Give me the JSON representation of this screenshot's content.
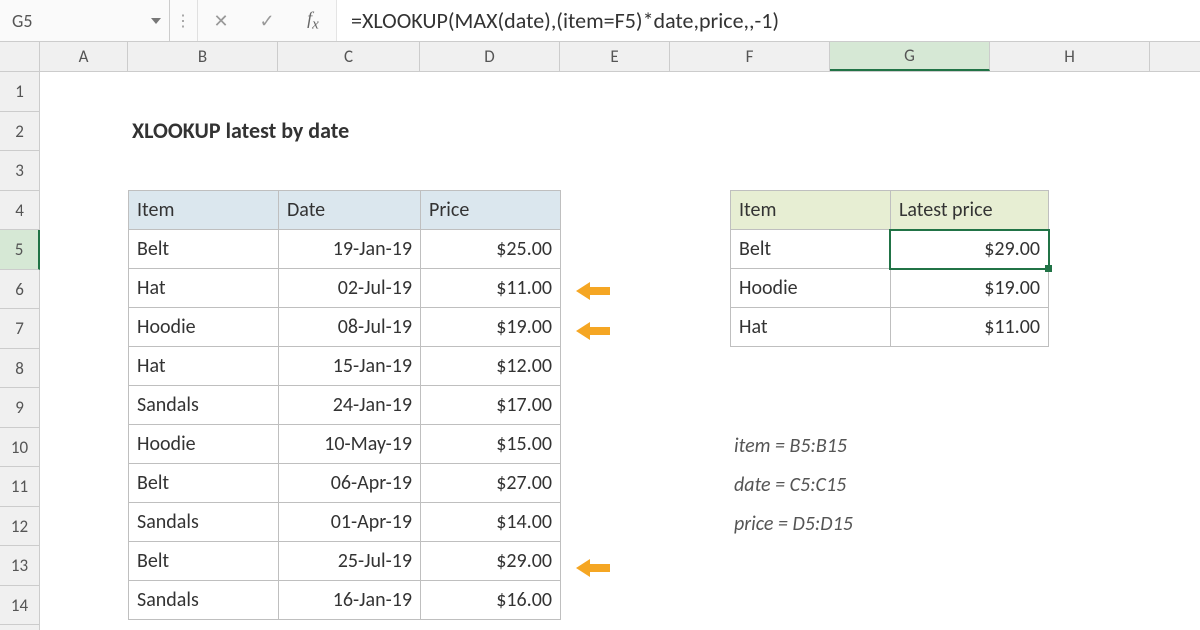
{
  "nameBox": "G5",
  "formula": "=XLOOKUP(MAX(date),(item=F5)*date,price,,-1)",
  "columns": [
    "A",
    "B",
    "C",
    "D",
    "E",
    "F",
    "G",
    "H"
  ],
  "rows": [
    "1",
    "2",
    "3",
    "4",
    "5",
    "6",
    "7",
    "8",
    "9",
    "10",
    "11",
    "12",
    "13",
    "14"
  ],
  "selectedCol": "G",
  "selectedRow": "5",
  "title": "XLOOKUP latest by date",
  "table": {
    "headers": {
      "item": "Item",
      "date": "Date",
      "price": "Price"
    },
    "rows": [
      {
        "item": "Belt",
        "date": "19-Jan-19",
        "price": "$25.00"
      },
      {
        "item": "Hat",
        "date": "02-Jul-19",
        "price": "$11.00"
      },
      {
        "item": "Hoodie",
        "date": "08-Jul-19",
        "price": "$19.00"
      },
      {
        "item": "Hat",
        "date": "15-Jan-19",
        "price": "$12.00"
      },
      {
        "item": "Sandals",
        "date": "24-Jan-19",
        "price": "$17.00"
      },
      {
        "item": "Hoodie",
        "date": "10-May-19",
        "price": "$15.00"
      },
      {
        "item": "Belt",
        "date": "06-Apr-19",
        "price": "$27.00"
      },
      {
        "item": "Sandals",
        "date": "01-Apr-19",
        "price": "$14.00"
      },
      {
        "item": "Belt",
        "date": "25-Jul-19",
        "price": "$29.00"
      },
      {
        "item": "Sandals",
        "date": "16-Jan-19",
        "price": "$16.00"
      }
    ]
  },
  "result": {
    "headers": {
      "item": "Item",
      "price": "Latest price"
    },
    "rows": [
      {
        "item": "Belt",
        "price": "$29.00"
      },
      {
        "item": "Hoodie",
        "price": "$19.00"
      },
      {
        "item": "Hat",
        "price": "$11.00"
      }
    ]
  },
  "ranges": {
    "item": "item = B5:B15",
    "date": "date = C5:C15",
    "price": "price = D5:D15"
  },
  "colors": {
    "arrow": "#f5a623"
  }
}
